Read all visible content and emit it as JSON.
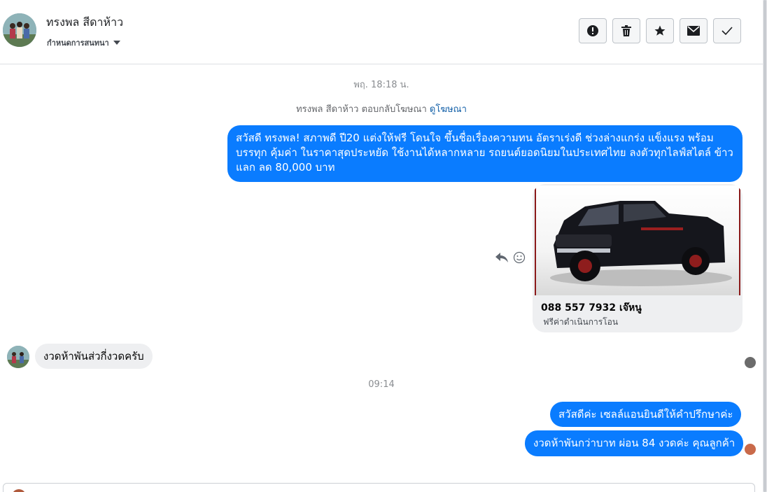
{
  "header": {
    "contact_name": "ทรงพล สีดาห้าว",
    "label_dropdown": "กำหนดการสนทนา",
    "actions": [
      {
        "name": "spam-button",
        "icon": "exclamation-circle-icon"
      },
      {
        "name": "delete-button",
        "icon": "trash-icon"
      },
      {
        "name": "star-button",
        "icon": "star-icon"
      },
      {
        "name": "mark-unread-button",
        "icon": "envelope-icon"
      },
      {
        "name": "mark-done-button",
        "icon": "check-icon"
      }
    ]
  },
  "thread": {
    "timestamp_1": "พฤ. 18:18 น.",
    "system_text": "ทรงพล สีดาห้าว ตอบกลับโฆษณา",
    "system_link": "ดูโฆษณา",
    "ad_message": "สวัสดี ทรงพล! สภาพดี ปี20 แต่งให้ฟรี โดนใจ ขึ้นชื่อเรื่องความทน อัตราเร่งดี ช่วงล่างแกร่ง แข็งแรง พร้อมบรรทุก คุ้มค่า ในราคาสุดประหยัด ใช้งานได้หลากหลาย รถยนต์ยอดนิยมในประเทศไทย ลงตัวทุกไลฟ์สไตล์ ข้าวแลก ลด 80,000 บาท",
    "ad_card": {
      "title": "088 557 7932 เจ๊หนู",
      "subtitle": "ฟรีค่าดำเนินการโอน",
      "image_icon": "pickup-truck-photo"
    },
    "incoming_message": "งวดห้าพันส่วกี่งวดครับ",
    "timestamp_2": "09:14",
    "reply_1": "สวัสดีค่ะ เซลล์แอนยินดีให้คำปรึกษาค่ะ",
    "reply_2": "งวดห้าพันกว่าบาท ผ่อน 84 งวดค่ะ คุณลูกค้า"
  },
  "colors": {
    "outgoing_bubble": "#0a7cff",
    "incoming_bubble": "#eeeff1",
    "link": "#1360a8"
  }
}
